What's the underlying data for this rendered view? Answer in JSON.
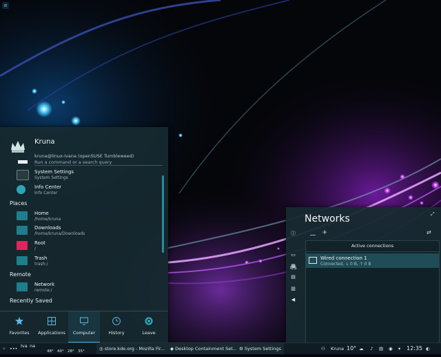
{
  "launcher": {
    "username": "Kruna",
    "user_address": "kruna@linux-ivana (openSUSE Tumbleweed)",
    "search_placeholder": "Run a command or a search query",
    "top_items": [
      {
        "title": "System Settings",
        "subtitle": "System Settings",
        "icon": "settings-icon"
      },
      {
        "title": "Info Center",
        "subtitle": "Info Center",
        "icon": "info-icon"
      }
    ],
    "sections": {
      "places": "Places",
      "remote": "Remote",
      "recent": "Recently Saved"
    },
    "places": [
      {
        "title": "Home",
        "subtitle": "/home/kruna",
        "icon": "home-folder-icon"
      },
      {
        "title": "Downloads",
        "subtitle": "/home/kruna/Downloads",
        "icon": "downloads-folder-icon"
      },
      {
        "title": "Root",
        "subtitle": "/",
        "icon": "root-folder-icon"
      },
      {
        "title": "Trash",
        "subtitle": "trash:/",
        "icon": "trash-icon"
      }
    ],
    "remote": [
      {
        "title": "Network",
        "subtitle": "remote:/",
        "icon": "network-folder-icon"
      }
    ],
    "tabs": [
      {
        "label": "Favorites",
        "icon": "star-icon"
      },
      {
        "label": "Applications",
        "icon": "grid-icon"
      },
      {
        "label": "Computer",
        "icon": "monitor-icon"
      },
      {
        "label": "History",
        "icon": "clock-icon"
      },
      {
        "label": "Leave",
        "icon": "power-icon"
      }
    ],
    "active_tab": "Computer"
  },
  "networks": {
    "title": "Networks",
    "sidebar_lang": "US",
    "list_header": "Active connections",
    "connection": {
      "name": "Wired connection 1",
      "status": "Connected, ↓ 0 B, ↑ 0 B"
    }
  },
  "panel": {
    "user": "Iva",
    "user_suffix": "na",
    "temps": [
      "48°",
      "40°",
      "28°",
      "35°"
    ],
    "tasks": [
      "store.kde.org - Mozilla Fir...",
      "Desktop Containment Set...",
      "System Settings"
    ],
    "tray_user": "Kruna",
    "weather": "10°",
    "clock": "12:35"
  },
  "colors": {
    "accent": "#3daee9",
    "panel_bg": "#172a30",
    "selection": "#1f4c56"
  }
}
